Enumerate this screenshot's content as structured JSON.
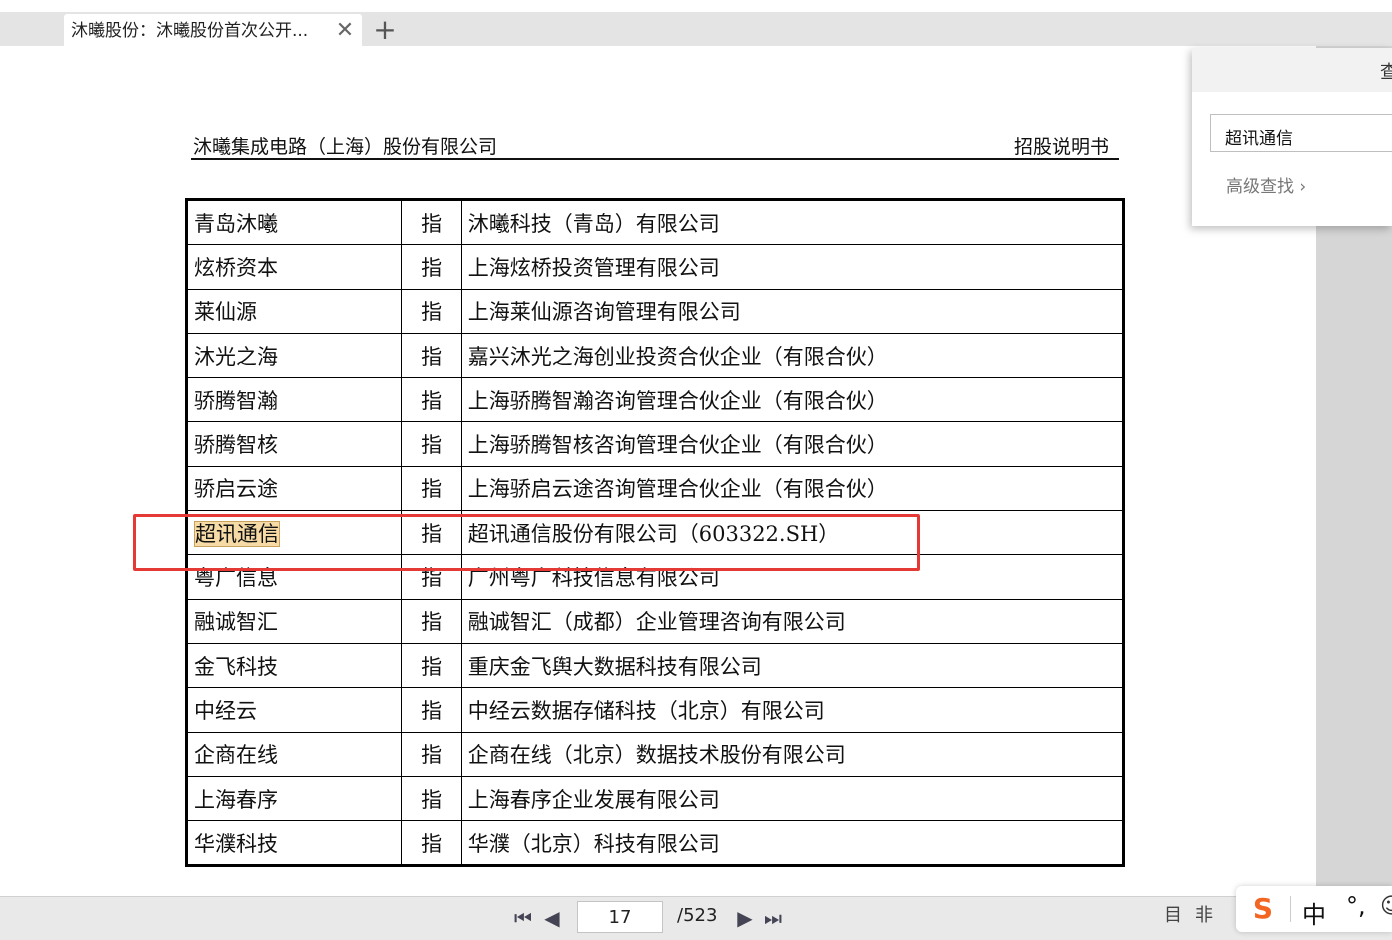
{
  "tabbar": {
    "active_tab_title": "沐曦股份：沐曦股份首次公开...",
    "close_glyph": "✕",
    "new_tab_glyph": "+"
  },
  "document": {
    "header_left": "沐曦集成电路（上海）股份有限公司",
    "header_right": "招股说明书",
    "rows": [
      {
        "term": "青岛沐曦",
        "ref": "指",
        "definition": "沐曦科技（青岛）有限公司"
      },
      {
        "term": "炫桥资本",
        "ref": "指",
        "definition": "上海炫桥投资管理有限公司"
      },
      {
        "term": "莱仙源",
        "ref": "指",
        "definition": "上海莱仙源咨询管理有限公司"
      },
      {
        "term": "沐光之海",
        "ref": "指",
        "definition": "嘉兴沐光之海创业投资合伙企业（有限合伙）"
      },
      {
        "term": "骄腾智瀚",
        "ref": "指",
        "definition": "上海骄腾智瀚咨询管理合伙企业（有限合伙）"
      },
      {
        "term": "骄腾智核",
        "ref": "指",
        "definition": "上海骄腾智核咨询管理合伙企业（有限合伙）"
      },
      {
        "term": "骄启云途",
        "ref": "指",
        "definition": "上海骄启云途咨询管理合伙企业（有限合伙）"
      },
      {
        "term": "超讯通信",
        "ref": "指",
        "definition": "超讯通信股份有限公司（603322.SH）",
        "highlighted": true
      },
      {
        "term": "粤广信息",
        "ref": "指",
        "definition": "广州粤广科技信息有限公司"
      },
      {
        "term": "融诚智汇",
        "ref": "指",
        "definition": "融诚智汇（成都）企业管理咨询有限公司"
      },
      {
        "term": "金飞科技",
        "ref": "指",
        "definition": "重庆金飞舆大数据科技有限公司"
      },
      {
        "term": "中经云",
        "ref": "指",
        "definition": "中经云数据存储科技（北京）有限公司"
      },
      {
        "term": "企商在线",
        "ref": "指",
        "definition": "企商在线（北京）数据技术股份有限公司"
      },
      {
        "term": "上海春序",
        "ref": "指",
        "definition": "上海春序企业发展有限公司"
      },
      {
        "term": "华濮科技",
        "ref": "指",
        "definition": "华濮（北京）科技有限公司"
      }
    ],
    "highlight_color": "#f6dba6",
    "annotation_box_color": "#e53935"
  },
  "find_panel": {
    "title": "查",
    "query": "超讯通信",
    "advanced_label": "高级查找 ›"
  },
  "bottombar": {
    "first_glyph": "⏮",
    "prev_glyph": "◀",
    "current_page": "17",
    "total_pages": "/523",
    "next_glyph": "▶",
    "last_glyph": "⏭",
    "single_page_icon": "目",
    "two_page_icon": "非"
  },
  "ime": {
    "logo": "S",
    "mode": "中",
    "punct": "°,",
    "more": "☺"
  }
}
